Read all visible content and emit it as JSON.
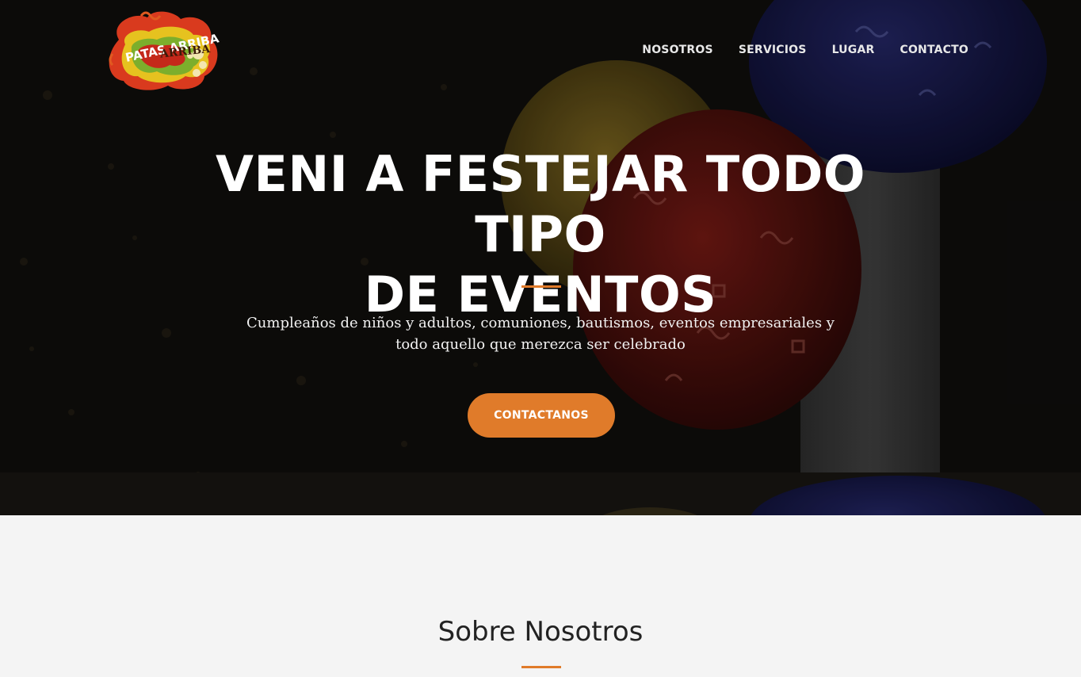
{
  "brand": {
    "logo_text": "PATAS ARRIBA",
    "colors": {
      "accent": "#e07b2a",
      "logo_red": "#d93a1e",
      "logo_yellow": "#e6c21f",
      "logo_green": "#7cae2c"
    }
  },
  "nav": {
    "items": [
      {
        "label": "NOSOTROS"
      },
      {
        "label": "SERVICIOS"
      },
      {
        "label": "LUGAR"
      },
      {
        "label": "CONTACTO"
      }
    ]
  },
  "hero": {
    "title_line1": "VENI A FESTEJAR TODO TIPO",
    "title_line2": "DE EVENTOS",
    "subtitle_line1": "Cumpleaños de niños y adultos, comuniones, bautismos, eventos empresariales y",
    "subtitle_line2": "todo aquello que merezca ser celebrado",
    "cta_label": "CONTACTANOS",
    "background": "party-balloons-photo"
  },
  "about": {
    "title": "Sobre Nosotros"
  }
}
